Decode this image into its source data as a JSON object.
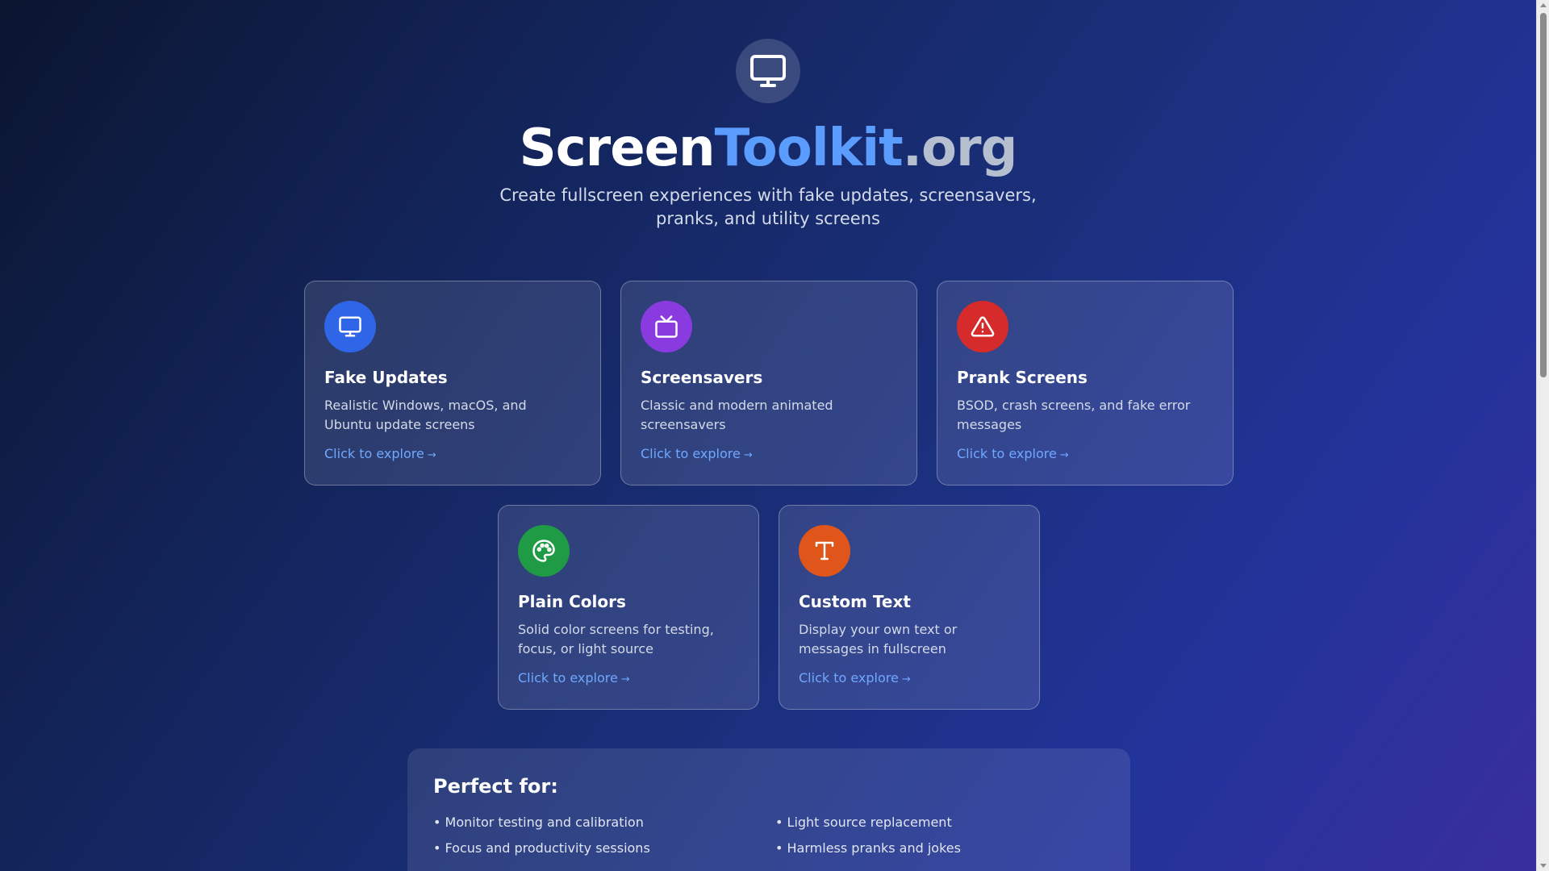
{
  "header": {
    "title_part1": "Screen",
    "title_part2": "Toolkit",
    "title_part3": ".org",
    "subtitle": "Create fullscreen experiences with fake updates, screensavers, pranks, and utility screens",
    "logo_icon": "monitor-icon"
  },
  "cards": [
    {
      "title": "Fake Updates",
      "description": "Realistic Windows, macOS, and Ubuntu update screens",
      "link": "Click to explore",
      "arrow": "→",
      "icon": "monitor-icon",
      "color": "#2f66e8"
    },
    {
      "title": "Screensavers",
      "description": "Classic and modern animated screensavers",
      "link": "Click to explore",
      "arrow": "→",
      "icon": "tv-icon",
      "color": "#8a3be0"
    },
    {
      "title": "Prank Screens",
      "description": "BSOD, crash screens, and fake error messages",
      "link": "Click to explore",
      "arrow": "→",
      "icon": "warning-icon",
      "color": "#d62b2b"
    },
    {
      "title": "Plain Colors",
      "description": "Solid color screens for testing, focus, or light source",
      "link": "Click to explore",
      "arrow": "→",
      "icon": "palette-icon",
      "color": "#1f9a45"
    },
    {
      "title": "Custom Text",
      "description": "Display your own text or messages in fullscreen",
      "link": "Click to explore",
      "arrow": "→",
      "icon": "text-icon",
      "color": "#e0561a"
    }
  ],
  "perfect_for": {
    "title": "Perfect for:",
    "left": [
      "• Monitor testing and calibration",
      "• Focus and productivity sessions"
    ],
    "right": [
      "• Light source replacement",
      "• Harmless pranks and jokes"
    ]
  },
  "colors": {
    "accent_blue": "#5b9dff",
    "link_blue": "#6fa8ff"
  }
}
